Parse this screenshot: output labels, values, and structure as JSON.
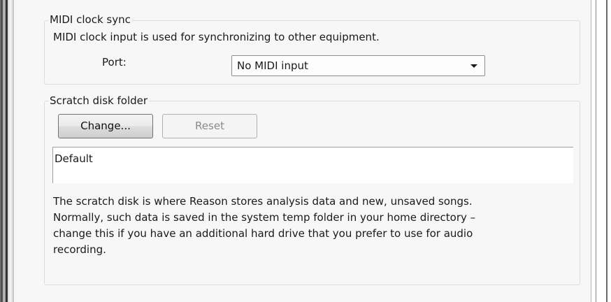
{
  "midi_clock_sync": {
    "title": "MIDI clock sync",
    "description": "MIDI clock input is used for synchronizing to other equipment.",
    "port_label": "Port:",
    "port_value": "No MIDI input"
  },
  "scratch_disk": {
    "title": "Scratch disk folder",
    "change_label": "Change...",
    "reset_label": "Reset",
    "path_value": "Default",
    "desc_lines": [
      "The scratch disk is where Reason stores analysis data and new, unsaved songs.",
      "Normally, such data is saved in the system temp folder in your home directory –",
      "change this if you have an additional hard drive that you prefer to use for audio",
      "recording."
    ]
  }
}
